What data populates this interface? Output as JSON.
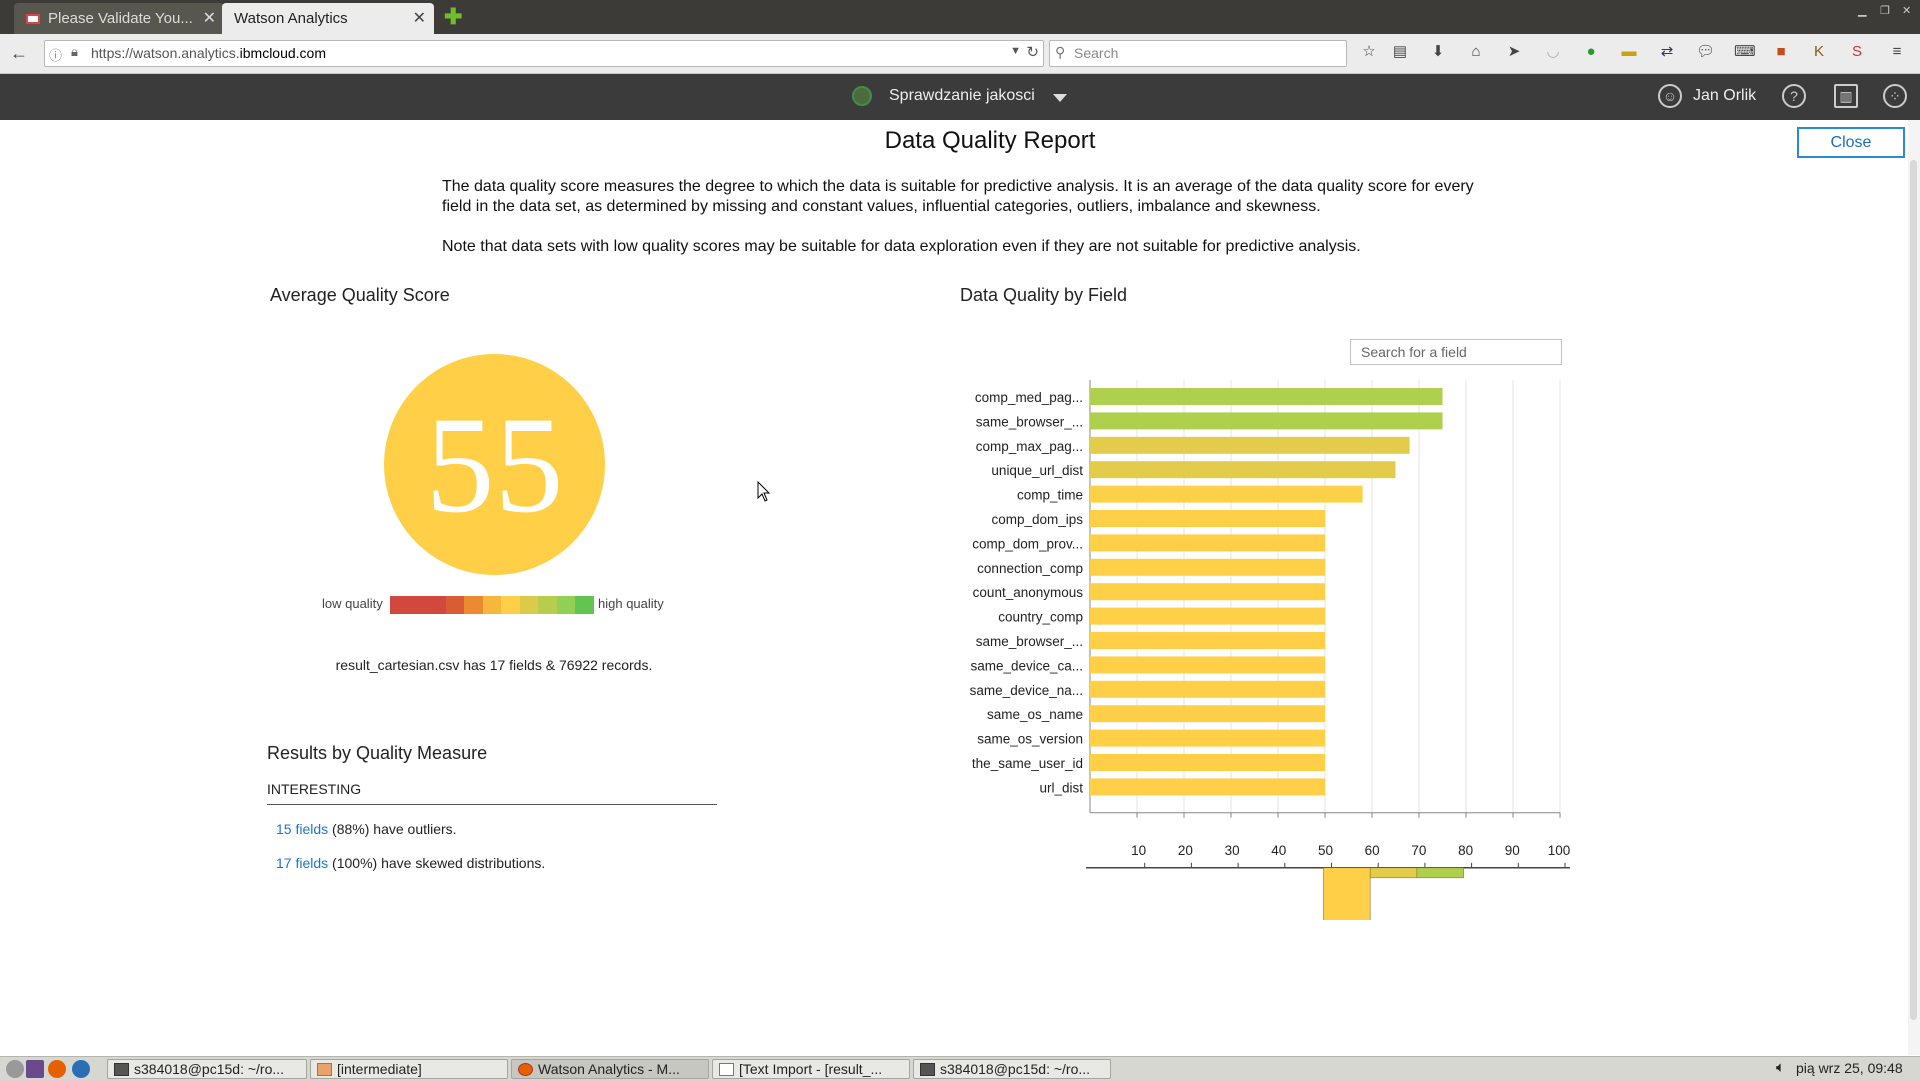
{
  "browser": {
    "tabs": [
      {
        "label": "Please Validate You...",
        "active": false
      },
      {
        "label": "Watson Analytics",
        "active": true
      }
    ],
    "url_prefix": "https://watson.analytics.",
    "url_domain": "ibmcloud.com",
    "search_placeholder": "Search"
  },
  "app": {
    "project_name": "Sprawdzanie jakosci",
    "user_name": "Jan Orlik"
  },
  "report": {
    "title": "Data Quality Report",
    "close_label": "Close",
    "description_1": "The data quality score measures the degree to which the data is suitable for predictive analysis. It is an average of the data quality score for every field in the data set, as determined by missing and constant values, influential categories, outliers, imbalance and skewness.",
    "description_2": "Note that data sets with low quality scores may be suitable for data exploration even if they are not suitable for predictive analysis.",
    "avg_title": "Average Quality Score",
    "score": "55",
    "legend_low": "low quality",
    "legend_high": "high quality",
    "legend_colors": [
      "#d0483e",
      "#d0483e",
      "#d0483e",
      "#d85d34",
      "#ec8a32",
      "#f5b83a",
      "#ffd047",
      "#dcca4b",
      "#b8cc4d",
      "#92cf55",
      "#62c551"
    ],
    "records_text": "result_cartesian.csv has 17 fields & 76922 records.",
    "results_title": "Results by Quality Measure",
    "results_subhead": "INTERESTING",
    "results": [
      {
        "link": "15 fields",
        "text": " (88%) have outliers."
      },
      {
        "link": "17 fields",
        "text": " (100%) have skewed distributions."
      }
    ],
    "by_field_title": "Data Quality by Field",
    "field_search_placeholder": "Search for a field"
  },
  "chart_data": {
    "type": "bar",
    "orientation": "horizontal",
    "categories": [
      "comp_med_pag...",
      "same_browser_...",
      "comp_max_pag...",
      "unique_url_dist",
      "comp_time",
      "comp_dom_ips",
      "comp_dom_prov...",
      "connection_comp",
      "count_anonymous",
      "country_comp",
      "same_browser_...",
      "same_device_ca...",
      "same_device_na...",
      "same_os_name",
      "same_os_version",
      "the_same_user_id",
      "url_dist"
    ],
    "values": [
      75,
      75,
      68,
      65,
      58,
      50,
      50,
      50,
      50,
      50,
      50,
      50,
      50,
      50,
      50,
      50,
      50
    ],
    "colors": [
      "#afcf4f",
      "#afcf4f",
      "#e3cc4b",
      "#e3cc4b",
      "#fcd047",
      "#ffd047",
      "#ffd047",
      "#ffd047",
      "#ffd047",
      "#ffd047",
      "#ffd047",
      "#ffd047",
      "#ffd047",
      "#ffd047",
      "#ffd047",
      "#ffd047",
      "#ffd047"
    ],
    "xlim": [
      0,
      100
    ],
    "x_ticks": [
      10,
      20,
      30,
      40,
      50,
      60,
      70,
      80,
      90,
      100
    ],
    "grid": true,
    "histogram": {
      "bins": [
        [
          50,
          60
        ],
        [
          60,
          70
        ],
        [
          70,
          80
        ]
      ],
      "counts": [
        13,
        2,
        2
      ],
      "colors": [
        "#ffd047",
        "#e3cc4b",
        "#afcf4f"
      ]
    }
  },
  "taskbar": {
    "tasks": [
      "s384018@pc15d: ~/ro...",
      "[intermediate]",
      "Watson Analytics - M...",
      "[Text Import - [result_...",
      "s384018@pc15d: ~/ro..."
    ],
    "clock": "pią wrz 25, 09:48"
  }
}
